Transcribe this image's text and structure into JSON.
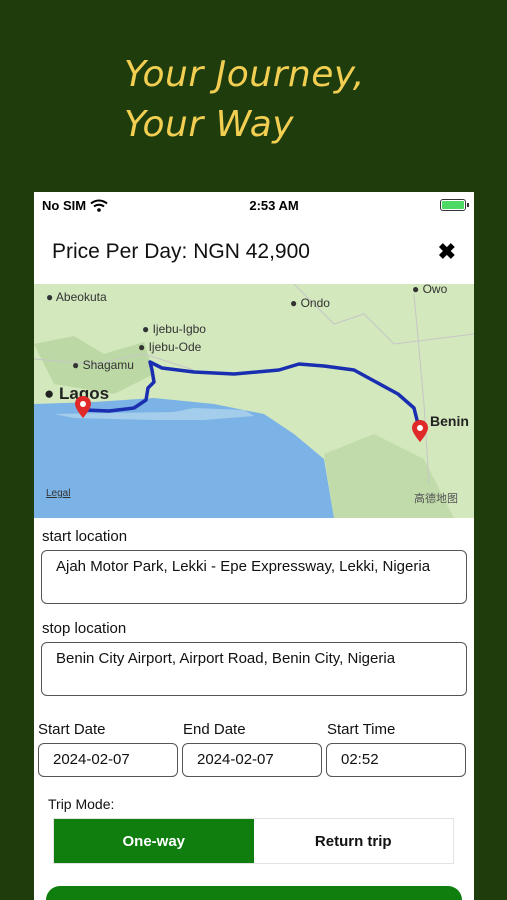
{
  "headline": {
    "line1": "Your Journey,",
    "line2": "Your Way"
  },
  "status_bar": {
    "carrier": "No SIM",
    "time": "2:53 AM"
  },
  "header": {
    "price_label": "Price Per Day: NGN 42,900"
  },
  "map": {
    "cities": [
      "Abeokuta",
      "Ondo",
      "Owo",
      "Ijebu-Igbo",
      "Ijebu-Ode",
      "Shagamu",
      "Lagos",
      "Benin"
    ],
    "legal": "Legal",
    "provider": "高德地图"
  },
  "form": {
    "start_label": "start location",
    "start_value": "Ajah Motor Park, Lekki - Epe Expressway, Lekki, Nigeria",
    "stop_label": "stop location",
    "stop_value": "Benin City Airport, Airport Road, Benin City, Nigeria",
    "start_date_label": "Start Date",
    "start_date": "2024-02-07",
    "end_date_label": "End Date",
    "end_date": "2024-02-07",
    "start_time_label": "Start Time",
    "start_time": "02:52",
    "trip_mode_label": "Trip Mode:",
    "trip_modes": [
      "One-way",
      "Return trip"
    ],
    "selected_mode": "One-way"
  },
  "colors": {
    "background": "#1f3d0c",
    "headline": "#f2cf52",
    "accent": "#0f7e0f",
    "route": "#1a2fb0"
  }
}
